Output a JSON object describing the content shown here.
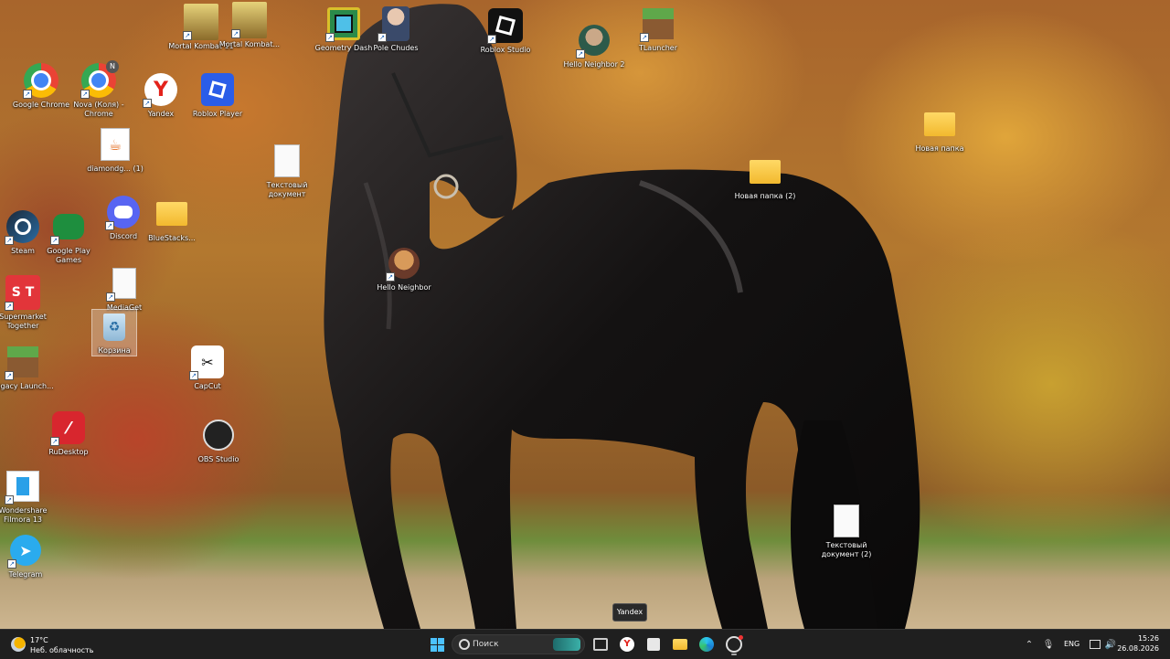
{
  "desktop": {
    "icons": [
      {
        "label": "Mortal Kombat 11"
      },
      {
        "label": "Mortal Kombat..."
      },
      {
        "label": "Geometry Dash"
      },
      {
        "label": "Pole Chudes"
      },
      {
        "label": "Roblox Studio"
      },
      {
        "label": "Hello Neighbor 2"
      },
      {
        "label": "TLauncher"
      },
      {
        "label": "Google Chrome"
      },
      {
        "label": "Nova (Коля) - Chrome"
      },
      {
        "label": "Yandex"
      },
      {
        "label": "Roblox Player"
      },
      {
        "label": "diamondg... (1)"
      },
      {
        "label": "Текстовый документ"
      },
      {
        "label": "Новая папка"
      },
      {
        "label": "Новая папка (2)"
      },
      {
        "label": "Steam"
      },
      {
        "label": "Google Play Games"
      },
      {
        "label": "Discord"
      },
      {
        "label": "BlueStacks..."
      },
      {
        "label": "Hello Neighbor"
      },
      {
        "label": "MediaGet"
      },
      {
        "label": "Supermarket Together"
      },
      {
        "label": "Корзина"
      },
      {
        "label": "Legacy Launch..."
      },
      {
        "label": "CapCut"
      },
      {
        "label": "RuDesktop"
      },
      {
        "label": "OBS Studio"
      },
      {
        "label": "Wondershare Filmora 13"
      },
      {
        "label": "Telegram"
      },
      {
        "label": "Текстовый документ (2)"
      }
    ],
    "nova_badge": "N",
    "tooltip": "Yandex"
  },
  "taskbar": {
    "weather": {
      "temp": "17°C",
      "desc": "Неб. облачность"
    },
    "search": {
      "placeholder": "Поиск"
    },
    "tray": {
      "lang": "ENG",
      "time": "15:26",
      "date": "26.08.2026"
    }
  },
  "colors": {
    "taskbar_bg": "#1f1f1f",
    "accent": "#0078d4"
  }
}
